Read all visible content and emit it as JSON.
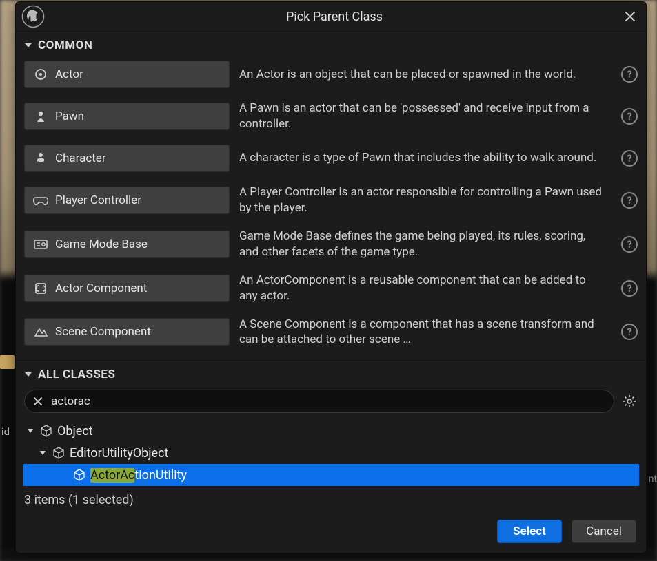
{
  "dialog": {
    "title": "Pick Parent Class"
  },
  "sections": {
    "common": "COMMON",
    "all": "ALL CLASSES"
  },
  "common_rows": [
    {
      "label": "Actor",
      "desc": "An Actor is an object that can be placed or spawned in the world."
    },
    {
      "label": "Pawn",
      "desc": "A Pawn is an actor that can be 'possessed' and receive input from a controller."
    },
    {
      "label": "Character",
      "desc": "A character is a type of Pawn that includes the ability to walk around."
    },
    {
      "label": "Player Controller",
      "desc": "A Player Controller is an actor responsible for controlling a Pawn used by the player."
    },
    {
      "label": "Game Mode Base",
      "desc": "Game Mode Base defines the game being played, its rules, scoring, and other facets of the game type."
    },
    {
      "label": "Actor Component",
      "desc": "An ActorComponent is a reusable component that can be added to any actor."
    },
    {
      "label": "Scene Component",
      "desc": "A Scene Component is a component that has a scene transform and can be attached to other scene …"
    }
  ],
  "search": {
    "value": "actorac"
  },
  "tree": {
    "items": [
      {
        "label": "Object"
      },
      {
        "label": "EditorUtilityObject"
      },
      {
        "label_match": "ActorAc",
        "label_rest": "tionUtility",
        "selected": true
      }
    ]
  },
  "status": "3 items (1 selected)",
  "footer": {
    "select": "Select",
    "cancel": "Cancel"
  }
}
